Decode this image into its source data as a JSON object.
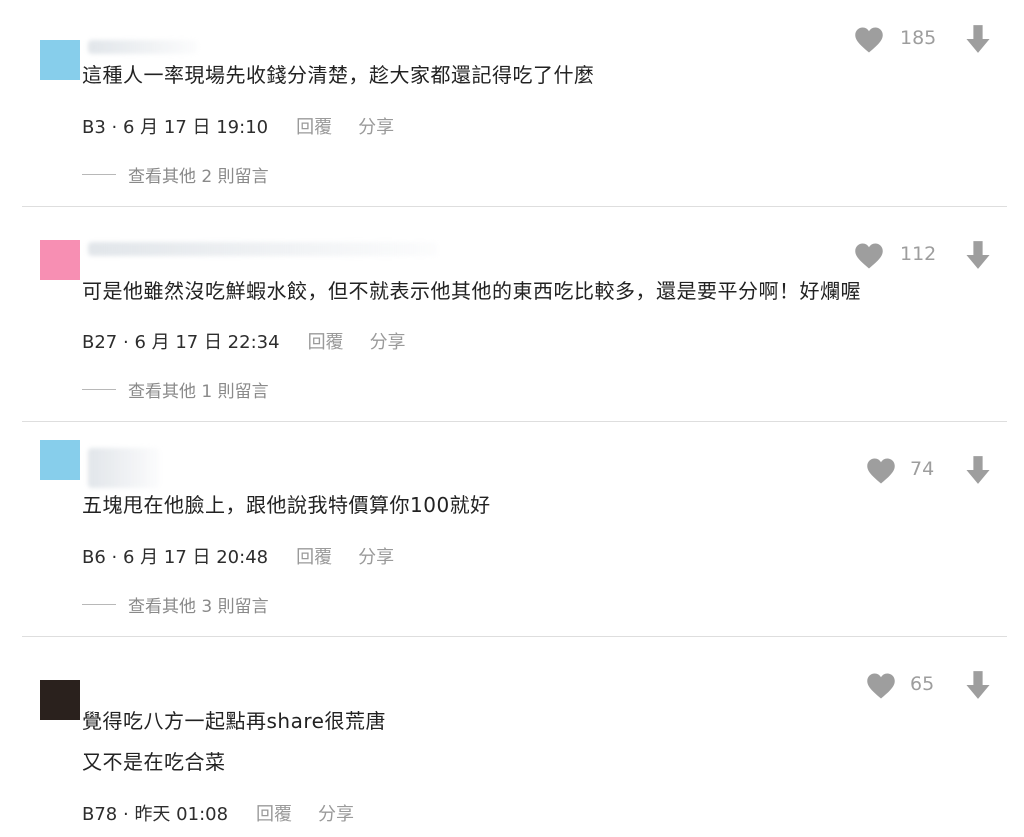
{
  "comments": [
    {
      "avatar_color": "#87ceeb",
      "text_lines": [
        "這種人一率現場先收錢分清楚，趁大家都還記得吃了什麼"
      ],
      "floor": "B3",
      "time": "6 月 17 日 19:10",
      "reply_label": "回覆",
      "share_label": "分享",
      "view_replies": "查看其他 2 則留言",
      "likes": "185"
    },
    {
      "avatar_color": "#f78fb3",
      "text_lines": [
        "可是他雖然沒吃鮮蝦水餃，但不就表示他其他的東西吃比較多，還是要平分啊！好爛喔"
      ],
      "floor": "B27",
      "time": "6 月 17 日 22:34",
      "reply_label": "回覆",
      "share_label": "分享",
      "view_replies": "查看其他 1 則留言",
      "likes": "112"
    },
    {
      "avatar_color": "#87ceeb",
      "text_lines": [
        "五塊甩在他臉上，跟他說我特價算你100就好"
      ],
      "floor": "B6",
      "time": "6 月 17 日 20:48",
      "reply_label": "回覆",
      "share_label": "分享",
      "view_replies": "查看其他 3 則留言",
      "likes": "74"
    },
    {
      "avatar_color": "#2a211d",
      "text_lines": [
        "覺得吃八方一起點再share很荒唐",
        "又不是在吃合菜"
      ],
      "floor": "B78",
      "time": "昨天 01:08",
      "reply_label": "回覆",
      "share_label": "分享",
      "likes": "65"
    }
  ],
  "icons": {
    "like": "heart-icon",
    "dislike": "down-arrow-icon"
  },
  "colors": {
    "icon_gray": "#9e9e9e",
    "divider": "#dedede"
  }
}
